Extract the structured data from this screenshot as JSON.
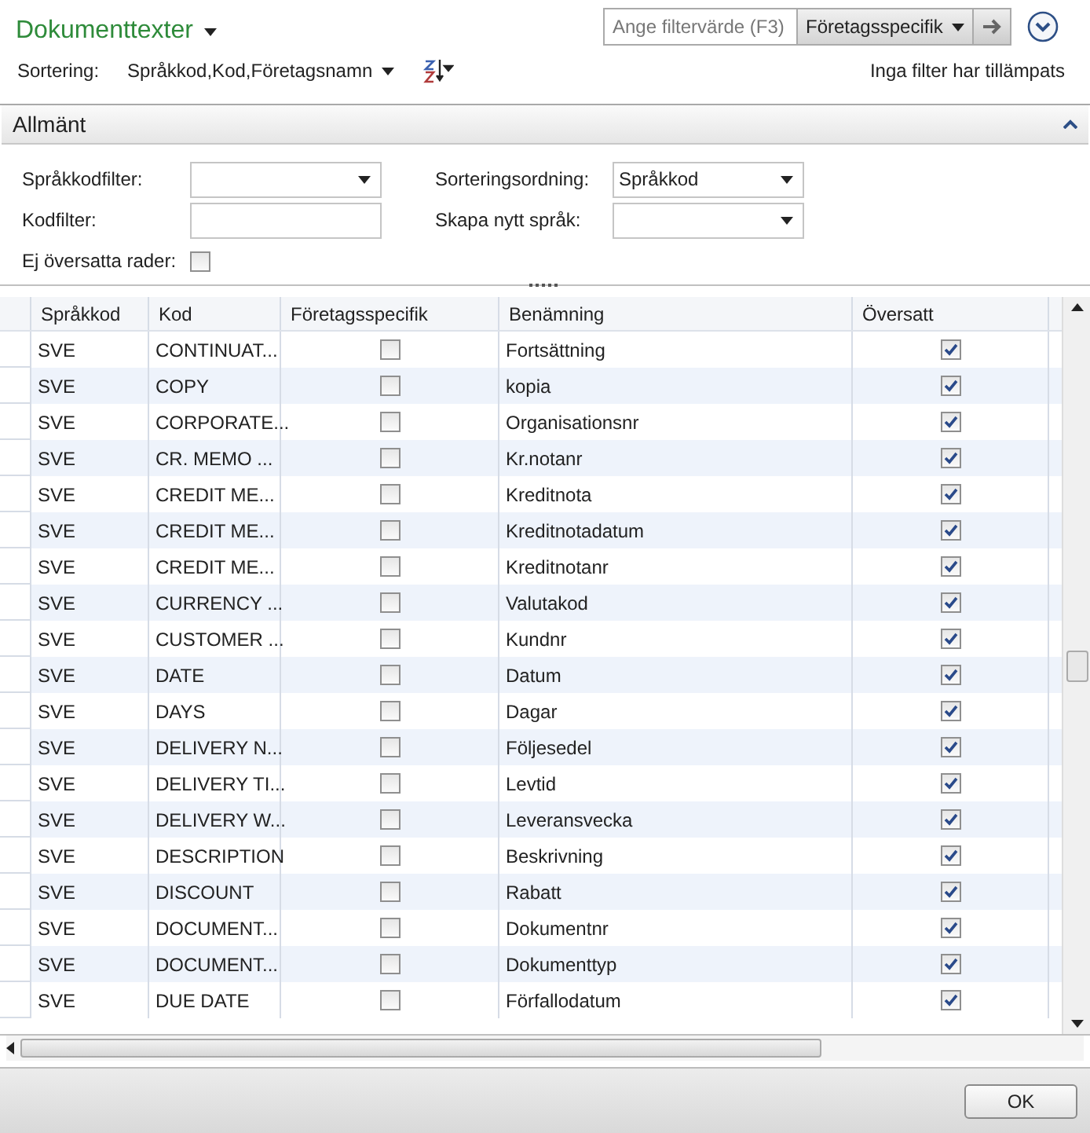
{
  "window": {
    "title": "Dokumenttexter"
  },
  "filter": {
    "placeholder": "Ange filtervärde (F3)",
    "field": "Företagsspecifik"
  },
  "sort": {
    "label": "Sortering:",
    "value": "Språkkod,Kod,Företagsnamn"
  },
  "filter_status": "Inga filter har tillämpats",
  "section": {
    "title": "Allmänt",
    "expanded": true,
    "fields": [
      {
        "label": "Språkkodfilter:",
        "kind": "dropdown"
      },
      {
        "label": "Sorteringsordning:",
        "kind": "dropdown",
        "value": "Språkkod"
      },
      {
        "label": "Kodfilter:",
        "kind": "text"
      },
      {
        "label": "Skapa nytt språk:",
        "kind": "dropdown"
      },
      {
        "label": "Ej översatta rader:",
        "kind": "checkbox",
        "checked": false
      }
    ]
  },
  "table": {
    "columns": [
      "Språkkod",
      "Kod",
      "Företagsspecifik",
      "Benämning",
      "Översatt"
    ],
    "rows": [
      {
        "language": "SVE",
        "code": "CONTINUAT...",
        "company_specific": false,
        "description": "Fortsättning",
        "translated": true
      },
      {
        "language": "SVE",
        "code": "COPY",
        "company_specific": false,
        "description": "kopia",
        "translated": true
      },
      {
        "language": "SVE",
        "code": "CORPORATE...",
        "company_specific": false,
        "description": "Organisationsnr",
        "translated": true
      },
      {
        "language": "SVE",
        "code": "CR. MEMO ...",
        "company_specific": false,
        "description": "Kr.notanr",
        "translated": true
      },
      {
        "language": "SVE",
        "code": "CREDIT ME...",
        "company_specific": false,
        "description": "Kreditnota",
        "translated": true
      },
      {
        "language": "SVE",
        "code": "CREDIT ME...",
        "company_specific": false,
        "description": "Kreditnotadatum",
        "translated": true
      },
      {
        "language": "SVE",
        "code": "CREDIT ME...",
        "company_specific": false,
        "description": "Kreditnotanr",
        "translated": true
      },
      {
        "language": "SVE",
        "code": "CURRENCY ...",
        "company_specific": false,
        "description": "Valutakod",
        "translated": true
      },
      {
        "language": "SVE",
        "code": "CUSTOMER ...",
        "company_specific": false,
        "description": "Kundnr",
        "translated": true
      },
      {
        "language": "SVE",
        "code": "DATE",
        "company_specific": false,
        "description": "Datum",
        "translated": true
      },
      {
        "language": "SVE",
        "code": "DAYS",
        "company_specific": false,
        "description": "Dagar",
        "translated": true
      },
      {
        "language": "SVE",
        "code": "DELIVERY N...",
        "company_specific": false,
        "description": "Följesedel",
        "translated": true
      },
      {
        "language": "SVE",
        "code": "DELIVERY TI...",
        "company_specific": false,
        "description": "Levtid",
        "translated": true
      },
      {
        "language": "SVE",
        "code": "DELIVERY W...",
        "company_specific": false,
        "description": "Leveransvecka",
        "translated": true
      },
      {
        "language": "SVE",
        "code": "DESCRIPTION",
        "company_specific": false,
        "description": "Beskrivning",
        "translated": true
      },
      {
        "language": "SVE",
        "code": "DISCOUNT",
        "company_specific": false,
        "description": "Rabatt",
        "translated": true
      },
      {
        "language": "SVE",
        "code": "DOCUMENT...",
        "company_specific": false,
        "description": "Dokumentnr",
        "translated": true
      },
      {
        "language": "SVE",
        "code": "DOCUMENT...",
        "company_specific": false,
        "description": "Dokumenttyp",
        "translated": true
      },
      {
        "language": "SVE",
        "code": "DUE DATE",
        "company_specific": false,
        "description": "Förfallodatum",
        "translated": true
      }
    ]
  },
  "buttons": [
    "OK"
  ]
}
